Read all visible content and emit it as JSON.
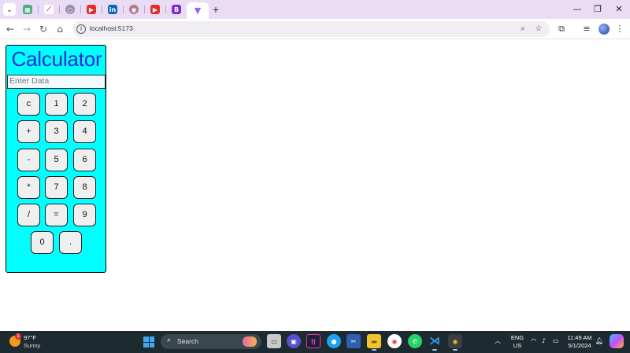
{
  "browser": {
    "tabs": [
      {
        "icon": "tab-list-icon",
        "color": "#ffffff"
      },
      {
        "icon": "calculator-tab-icon",
        "color": "#4caf7d",
        "glyph": "▦"
      },
      {
        "icon": "slash-tab-icon",
        "color": "#ffffff",
        "glyph": "⟋"
      },
      {
        "icon": "github-tab-icon",
        "color": "#9a8dab",
        "glyph": "○"
      },
      {
        "icon": "youtube-tab-icon",
        "color": "#e52d27",
        "glyph": "▶"
      },
      {
        "icon": "linkedin-tab-icon",
        "color": "#0a66c2",
        "glyph": "in"
      },
      {
        "icon": "globe-tab-icon",
        "color": "#b07a8e",
        "glyph": "◉"
      },
      {
        "icon": "youtube-tab-icon",
        "color": "#e52d27",
        "glyph": "▶"
      },
      {
        "icon": "bootstrap-tab-icon",
        "color": "#7b2bd6",
        "glyph": "B"
      },
      {
        "icon": "vite-tab-icon",
        "color": "#ffffff",
        "glyph": "▼"
      }
    ],
    "new_tab": "+",
    "url": "localhost:5173"
  },
  "calculator": {
    "title": "Calculator",
    "input_placeholder": "Enter Data",
    "keys": [
      "c",
      "1",
      "2",
      "+",
      "3",
      "4",
      "-",
      "5",
      "6",
      "*",
      "7",
      "8",
      "/",
      "=",
      "9",
      "0",
      "."
    ]
  },
  "taskbar": {
    "weather_temp": "97°F",
    "weather_cond": "Sunny",
    "weather_badge": "1",
    "search_label": "Search",
    "lang_line1": "ENG",
    "lang_line2": "US",
    "time": "11:49 AM",
    "date": "5/1/2024"
  },
  "colors": {
    "calc_bg": "#00ffff",
    "title": "#1a2bd6",
    "tabstrip": "#e9dcf4",
    "taskbar": "#1d2a30"
  }
}
